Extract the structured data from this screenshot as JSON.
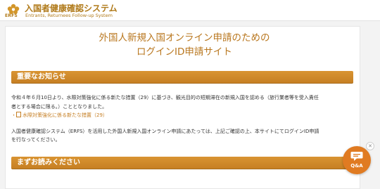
{
  "header": {
    "logo_abbr": "ERFS",
    "title": "入国者健康確認システム",
    "subtitle": "Entrants, Returnees Follow-up System"
  },
  "page": {
    "title_line1": "外国人新規入国オンライン申請のための",
    "title_line2": "ログインID申請サイト"
  },
  "notice": {
    "heading": "重要なお知らせ",
    "line1": "令和４年６月10日より、水際対策強化に係る新たな措置（29）に基づき、観光目的の短期滞在の新規入国を認める（旅行業者等を受入責任",
    "line2": "者とする場合に限る。）こととなりました。",
    "link_bullet": "・",
    "link_label": "水際対策強化に係る新たな措置（29）",
    "para2_line1": "入国者健康確認システム（ERFS）を活用した外国人新規入国オンライン申請にあたっては、上記ご確認の上、本サイトにてログインID申請",
    "para2_line2": "を行なってください。"
  },
  "read_first": {
    "heading": "まずお読みください"
  },
  "qa": {
    "label": "Q&A",
    "close": "✕"
  },
  "colors": {
    "accent": "#c57e22",
    "title": "#b9771f",
    "qa": "#e07b22"
  }
}
